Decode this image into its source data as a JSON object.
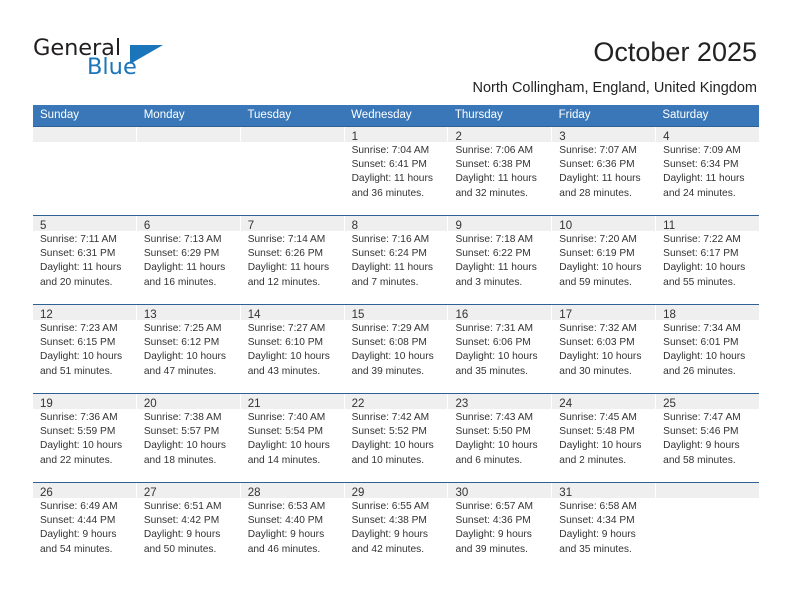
{
  "brand": {
    "word1": "General",
    "word2": "Blue"
  },
  "header": {
    "title": "October 2025",
    "location": "North Collingham, England, United Kingdom"
  },
  "calendar": {
    "weekdays": [
      "Sunday",
      "Monday",
      "Tuesday",
      "Wednesday",
      "Thursday",
      "Friday",
      "Saturday"
    ],
    "colors": {
      "header_bg": "#3a77b8",
      "header_text": "#ffffff",
      "row_divider": "#2e6296",
      "daynum_band": "#efefef",
      "brand_blue": "#1a75bb"
    },
    "weeks": [
      [
        {
          "day": "",
          "sunrise": "",
          "sunset": "",
          "daylight1": "",
          "daylight2": ""
        },
        {
          "day": "",
          "sunrise": "",
          "sunset": "",
          "daylight1": "",
          "daylight2": ""
        },
        {
          "day": "",
          "sunrise": "",
          "sunset": "",
          "daylight1": "",
          "daylight2": ""
        },
        {
          "day": "1",
          "sunrise": "Sunrise: 7:04 AM",
          "sunset": "Sunset: 6:41 PM",
          "daylight1": "Daylight: 11 hours",
          "daylight2": "and 36 minutes."
        },
        {
          "day": "2",
          "sunrise": "Sunrise: 7:06 AM",
          "sunset": "Sunset: 6:38 PM",
          "daylight1": "Daylight: 11 hours",
          "daylight2": "and 32 minutes."
        },
        {
          "day": "3",
          "sunrise": "Sunrise: 7:07 AM",
          "sunset": "Sunset: 6:36 PM",
          "daylight1": "Daylight: 11 hours",
          "daylight2": "and 28 minutes."
        },
        {
          "day": "4",
          "sunrise": "Sunrise: 7:09 AM",
          "sunset": "Sunset: 6:34 PM",
          "daylight1": "Daylight: 11 hours",
          "daylight2": "and 24 minutes."
        }
      ],
      [
        {
          "day": "5",
          "sunrise": "Sunrise: 7:11 AM",
          "sunset": "Sunset: 6:31 PM",
          "daylight1": "Daylight: 11 hours",
          "daylight2": "and 20 minutes."
        },
        {
          "day": "6",
          "sunrise": "Sunrise: 7:13 AM",
          "sunset": "Sunset: 6:29 PM",
          "daylight1": "Daylight: 11 hours",
          "daylight2": "and 16 minutes."
        },
        {
          "day": "7",
          "sunrise": "Sunrise: 7:14 AM",
          "sunset": "Sunset: 6:26 PM",
          "daylight1": "Daylight: 11 hours",
          "daylight2": "and 12 minutes."
        },
        {
          "day": "8",
          "sunrise": "Sunrise: 7:16 AM",
          "sunset": "Sunset: 6:24 PM",
          "daylight1": "Daylight: 11 hours",
          "daylight2": "and 7 minutes."
        },
        {
          "day": "9",
          "sunrise": "Sunrise: 7:18 AM",
          "sunset": "Sunset: 6:22 PM",
          "daylight1": "Daylight: 11 hours",
          "daylight2": "and 3 minutes."
        },
        {
          "day": "10",
          "sunrise": "Sunrise: 7:20 AM",
          "sunset": "Sunset: 6:19 PM",
          "daylight1": "Daylight: 10 hours",
          "daylight2": "and 59 minutes."
        },
        {
          "day": "11",
          "sunrise": "Sunrise: 7:22 AM",
          "sunset": "Sunset: 6:17 PM",
          "daylight1": "Daylight: 10 hours",
          "daylight2": "and 55 minutes."
        }
      ],
      [
        {
          "day": "12",
          "sunrise": "Sunrise: 7:23 AM",
          "sunset": "Sunset: 6:15 PM",
          "daylight1": "Daylight: 10 hours",
          "daylight2": "and 51 minutes."
        },
        {
          "day": "13",
          "sunrise": "Sunrise: 7:25 AM",
          "sunset": "Sunset: 6:12 PM",
          "daylight1": "Daylight: 10 hours",
          "daylight2": "and 47 minutes."
        },
        {
          "day": "14",
          "sunrise": "Sunrise: 7:27 AM",
          "sunset": "Sunset: 6:10 PM",
          "daylight1": "Daylight: 10 hours",
          "daylight2": "and 43 minutes."
        },
        {
          "day": "15",
          "sunrise": "Sunrise: 7:29 AM",
          "sunset": "Sunset: 6:08 PM",
          "daylight1": "Daylight: 10 hours",
          "daylight2": "and 39 minutes."
        },
        {
          "day": "16",
          "sunrise": "Sunrise: 7:31 AM",
          "sunset": "Sunset: 6:06 PM",
          "daylight1": "Daylight: 10 hours",
          "daylight2": "and 35 minutes."
        },
        {
          "day": "17",
          "sunrise": "Sunrise: 7:32 AM",
          "sunset": "Sunset: 6:03 PM",
          "daylight1": "Daylight: 10 hours",
          "daylight2": "and 30 minutes."
        },
        {
          "day": "18",
          "sunrise": "Sunrise: 7:34 AM",
          "sunset": "Sunset: 6:01 PM",
          "daylight1": "Daylight: 10 hours",
          "daylight2": "and 26 minutes."
        }
      ],
      [
        {
          "day": "19",
          "sunrise": "Sunrise: 7:36 AM",
          "sunset": "Sunset: 5:59 PM",
          "daylight1": "Daylight: 10 hours",
          "daylight2": "and 22 minutes."
        },
        {
          "day": "20",
          "sunrise": "Sunrise: 7:38 AM",
          "sunset": "Sunset: 5:57 PM",
          "daylight1": "Daylight: 10 hours",
          "daylight2": "and 18 minutes."
        },
        {
          "day": "21",
          "sunrise": "Sunrise: 7:40 AM",
          "sunset": "Sunset: 5:54 PM",
          "daylight1": "Daylight: 10 hours",
          "daylight2": "and 14 minutes."
        },
        {
          "day": "22",
          "sunrise": "Sunrise: 7:42 AM",
          "sunset": "Sunset: 5:52 PM",
          "daylight1": "Daylight: 10 hours",
          "daylight2": "and 10 minutes."
        },
        {
          "day": "23",
          "sunrise": "Sunrise: 7:43 AM",
          "sunset": "Sunset: 5:50 PM",
          "daylight1": "Daylight: 10 hours",
          "daylight2": "and 6 minutes."
        },
        {
          "day": "24",
          "sunrise": "Sunrise: 7:45 AM",
          "sunset": "Sunset: 5:48 PM",
          "daylight1": "Daylight: 10 hours",
          "daylight2": "and 2 minutes."
        },
        {
          "day": "25",
          "sunrise": "Sunrise: 7:47 AM",
          "sunset": "Sunset: 5:46 PM",
          "daylight1": "Daylight: 9 hours",
          "daylight2": "and 58 minutes."
        }
      ],
      [
        {
          "day": "26",
          "sunrise": "Sunrise: 6:49 AM",
          "sunset": "Sunset: 4:44 PM",
          "daylight1": "Daylight: 9 hours",
          "daylight2": "and 54 minutes."
        },
        {
          "day": "27",
          "sunrise": "Sunrise: 6:51 AM",
          "sunset": "Sunset: 4:42 PM",
          "daylight1": "Daylight: 9 hours",
          "daylight2": "and 50 minutes."
        },
        {
          "day": "28",
          "sunrise": "Sunrise: 6:53 AM",
          "sunset": "Sunset: 4:40 PM",
          "daylight1": "Daylight: 9 hours",
          "daylight2": "and 46 minutes."
        },
        {
          "day": "29",
          "sunrise": "Sunrise: 6:55 AM",
          "sunset": "Sunset: 4:38 PM",
          "daylight1": "Daylight: 9 hours",
          "daylight2": "and 42 minutes."
        },
        {
          "day": "30",
          "sunrise": "Sunrise: 6:57 AM",
          "sunset": "Sunset: 4:36 PM",
          "daylight1": "Daylight: 9 hours",
          "daylight2": "and 39 minutes."
        },
        {
          "day": "31",
          "sunrise": "Sunrise: 6:58 AM",
          "sunset": "Sunset: 4:34 PM",
          "daylight1": "Daylight: 9 hours",
          "daylight2": "and 35 minutes."
        },
        {
          "day": "",
          "sunrise": "",
          "sunset": "",
          "daylight1": "",
          "daylight2": ""
        }
      ]
    ]
  }
}
